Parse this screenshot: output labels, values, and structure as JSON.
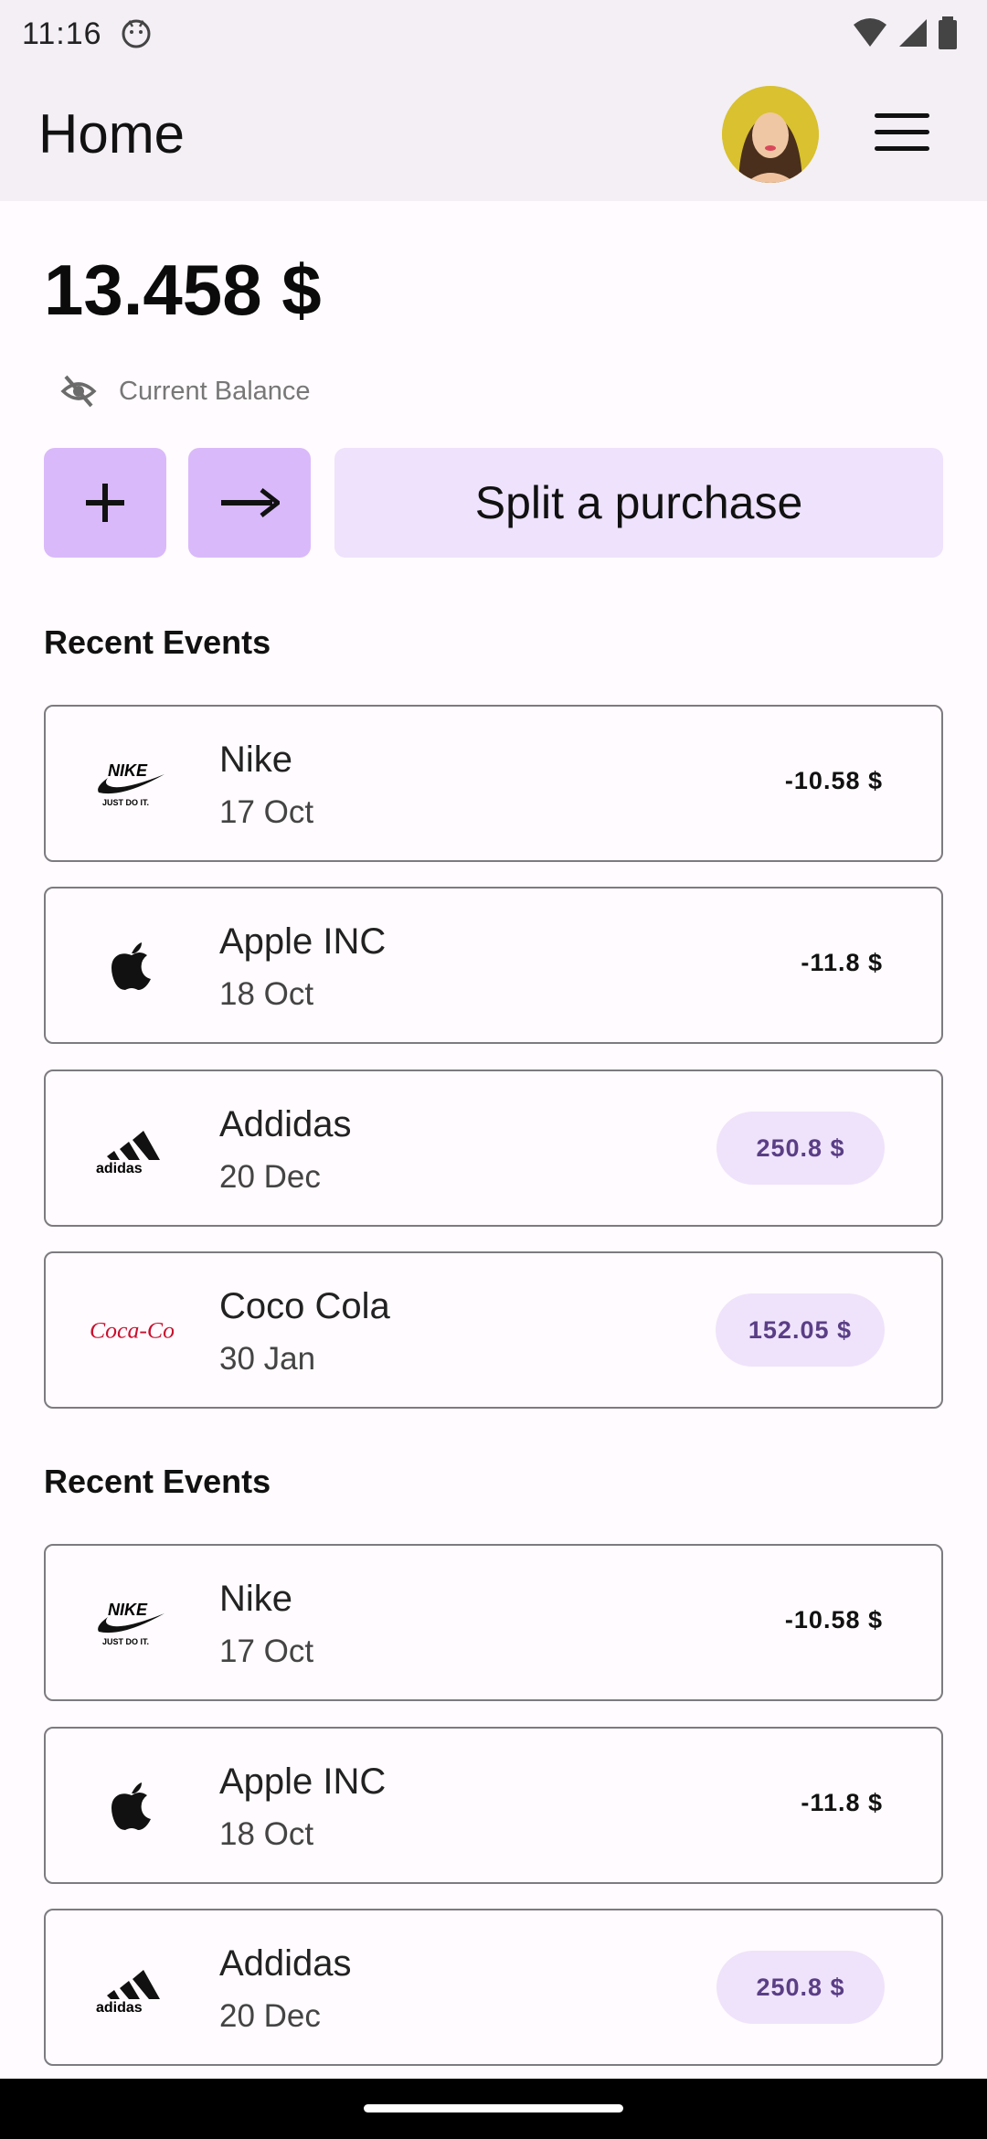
{
  "status_bar": {
    "time": "11:16"
  },
  "app_bar": {
    "title": "Home"
  },
  "balance": {
    "amount": "13.458 $",
    "label": "Current Balance"
  },
  "actions": {
    "split_label": "Split a purchase"
  },
  "sections": [
    {
      "title": "Recent Events",
      "events": [
        {
          "name": "Nike",
          "date": "17 Oct",
          "amount": "-10.58 $",
          "logo": "nike-logo",
          "style": "plain"
        },
        {
          "name": "Apple INC",
          "date": "18 Oct",
          "amount": "-11.8 $",
          "logo": "apple-logo",
          "style": "plain"
        },
        {
          "name": "Addidas",
          "date": "20 Dec",
          "amount": "250.8 $",
          "logo": "adidas-logo",
          "style": "pill"
        },
        {
          "name": "Coco Cola",
          "date": "30 Jan",
          "amount": "152.05 $",
          "logo": "coca-cola-logo",
          "style": "pill"
        }
      ]
    },
    {
      "title": "Recent Events",
      "events": [
        {
          "name": "Nike",
          "date": "17 Oct",
          "amount": "-10.58 $",
          "logo": "nike-logo",
          "style": "plain"
        },
        {
          "name": "Apple INC",
          "date": "18 Oct",
          "amount": "-11.8 $",
          "logo": "apple-logo",
          "style": "plain"
        },
        {
          "name": "Addidas",
          "date": "20 Dec",
          "amount": "250.8 $",
          "logo": "adidas-logo",
          "style": "pill"
        }
      ]
    }
  ],
  "colors": {
    "accent": "#D9B9FA",
    "accent_light": "#EEE2FC",
    "pill_text": "#5A3E85",
    "coca_cola_red": "#C8102E"
  }
}
